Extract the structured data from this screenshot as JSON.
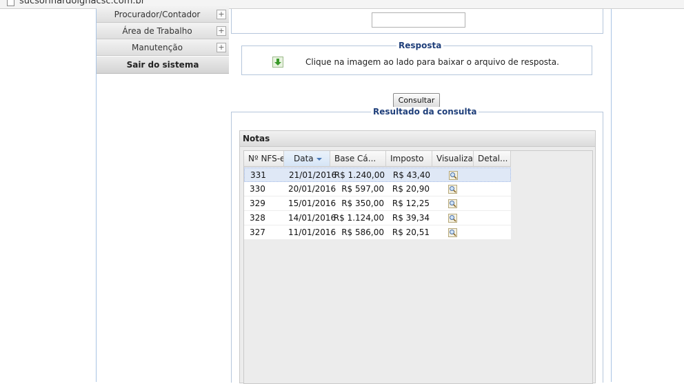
{
  "browser": {
    "address": "sucsorinardoignacsc.com.br"
  },
  "sidebar": {
    "items": [
      {
        "label": "Procurador/Contador"
      },
      {
        "label": "Área de Trabalho"
      },
      {
        "label": "Manutenção"
      }
    ],
    "logout_label": "Sair do sistema"
  },
  "resposta": {
    "legend": "Resposta",
    "text": "Clique na imagem ao lado para baixar o arquivo de resposta.",
    "icon": "download-arrow-icon"
  },
  "consultar_label": "Consultar",
  "resultado": {
    "legend": "Resultado da consulta",
    "grid_title": "Notas",
    "columns": [
      "Nº NFS-e",
      "Data",
      "Base Cá...",
      "Imposto",
      "Visualizar",
      "Detal..."
    ],
    "sorted_column": "Data",
    "rows": [
      {
        "nfse": "331",
        "data": "21/01/2016",
        "base": "R$ 1.240,00",
        "imposto": "R$ 43,40",
        "selected": true
      },
      {
        "nfse": "330",
        "data": "20/01/2016",
        "base": "R$ 597,00",
        "imposto": "R$ 20,90"
      },
      {
        "nfse": "329",
        "data": "15/01/2016",
        "base": "R$ 350,00",
        "imposto": "R$ 12,25"
      },
      {
        "nfse": "328",
        "data": "14/01/2016",
        "base": "R$ 1.124,00",
        "imposto": "R$ 39,34"
      },
      {
        "nfse": "327",
        "data": "11/01/2016",
        "base": "R$ 586,00",
        "imposto": "R$ 20,51"
      }
    ]
  },
  "colors": {
    "legend": "#1f3f7a",
    "border": "#b5c6db",
    "selected_row": "#dfe8f6"
  }
}
